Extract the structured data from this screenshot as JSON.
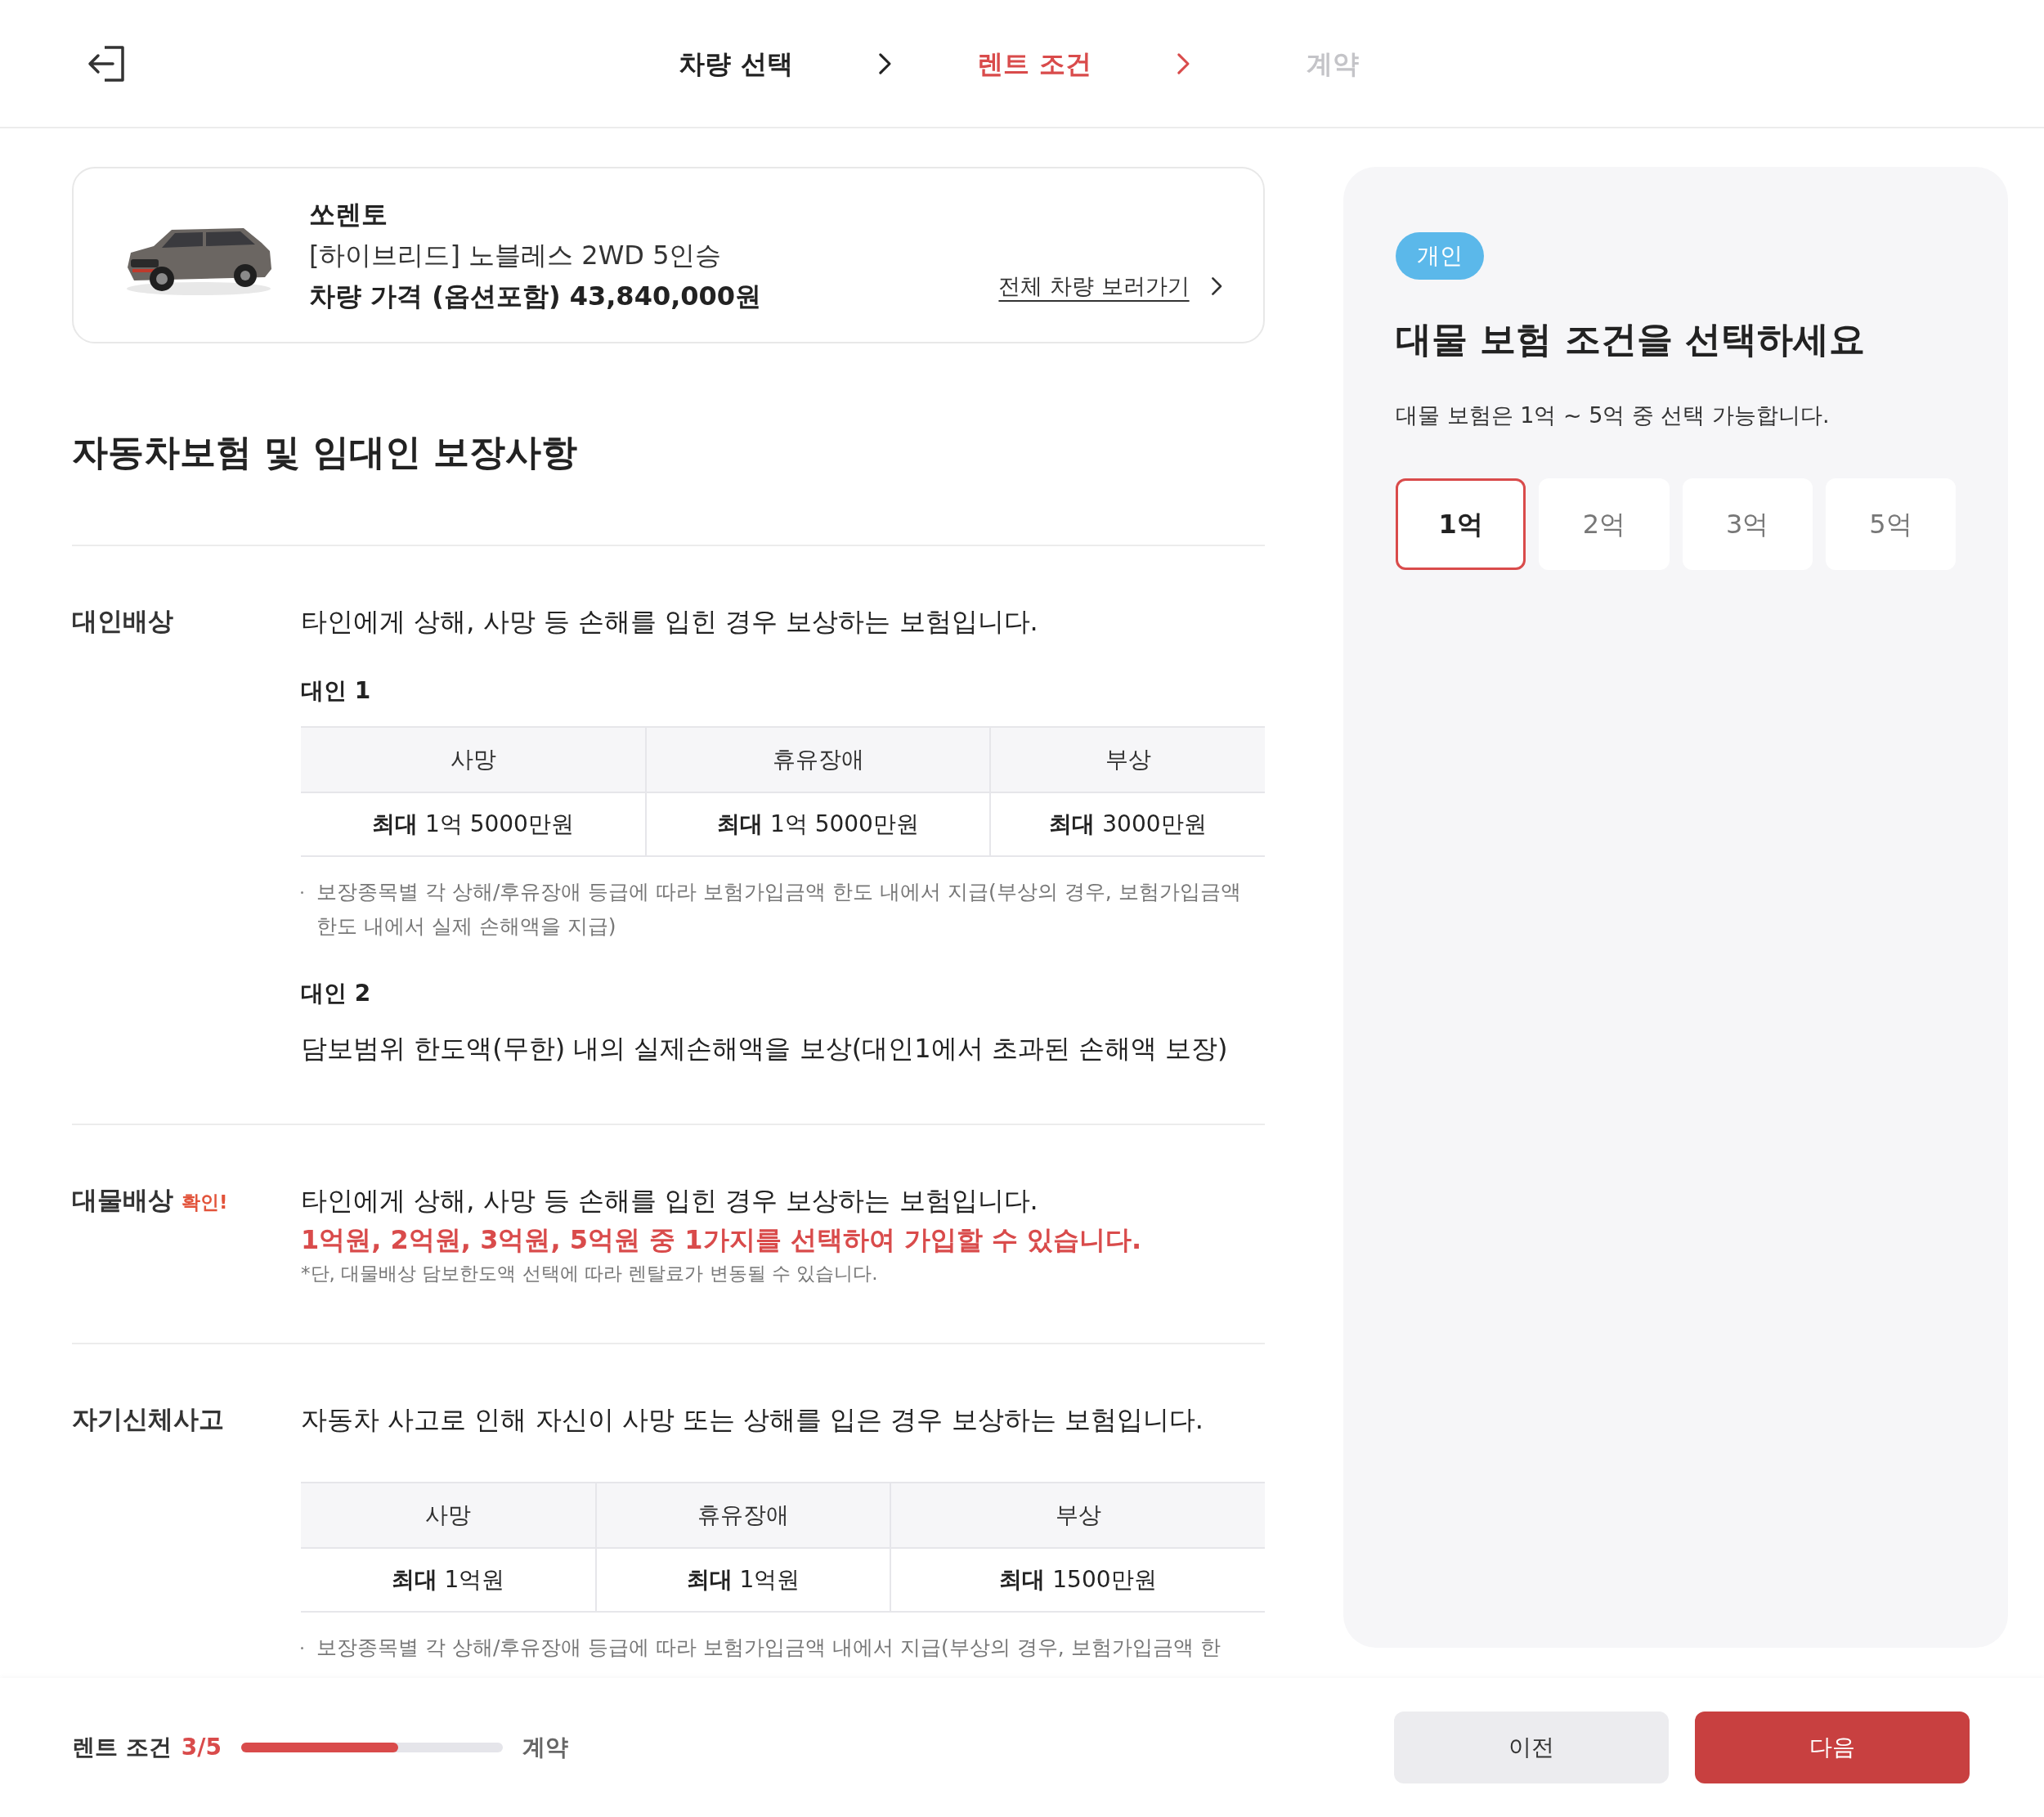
{
  "header": {
    "steps": [
      {
        "label": "차량 선택",
        "done": true,
        "selected": false
      },
      {
        "label": "렌트 조건",
        "done": false,
        "selected": true
      },
      {
        "label": "계약",
        "done": false,
        "selected": false
      }
    ]
  },
  "car": {
    "name": "쏘렌토",
    "trim": "[하이브리드] 노블레스 2WD 5인승",
    "price": "차량 가격 (옵션포함) 43,840,000원",
    "link": "전체 차량 보러가기"
  },
  "title": "자동차보험 및 임대인 보장사항",
  "sections": [
    {
      "label": "대인배상",
      "blocks": [
        {
          "kind": "text",
          "text": "타인에게 상해, 사망 등 손해를 입힌 경우 보상하는 보험입니다."
        },
        {
          "kind": "subheading",
          "text": "대인 1"
        },
        {
          "kind": "table",
          "columns": [
            "사망",
            "휴유장애",
            "부상"
          ],
          "rows": [
            [
              "**최대** 1억 5000만원",
              "**최대** 1억 5000만원",
              "**최대** 3000만원"
            ]
          ]
        },
        {
          "kind": "note",
          "text": "보장종목별 각 상해/후유장애 등급에 따라 보험가입금액 한도 내에서 지급(부상의 경우, 보험가입금액 한도 내에서 실제 손해액을 지급)"
        },
        {
          "kind": "subheading",
          "text": "대인 2"
        },
        {
          "kind": "text",
          "text": "담보범위 한도액(무한) 내의 실제손해액을 보상(대인1에서 초과된 손해액 보장)"
        }
      ]
    },
    {
      "label": "대물배상",
      "badge": "확인!",
      "blocks": [
        {
          "kind": "text",
          "text": "타인에게 상해, 사망 등 손해를 입힌 경우 보상하는 보험입니다."
        },
        {
          "kind": "highlight",
          "text": "1억원, 2억원, 3억원, 5억원 중 1가지를 선택하여 가입할 수 있습니다."
        },
        {
          "kind": "footnote",
          "text": "*단, 대물배상 담보한도액 선택에 따라 렌탈료가 변동될 수 있습니다."
        }
      ]
    },
    {
      "label": "자기신체사고",
      "blocks": [
        {
          "kind": "text",
          "text": "자동차 사고로 인해 자신이 사망 또는 상해를 입은 경우 보상하는 보험입니다."
        },
        {
          "kind": "table",
          "columns": [
            "사망",
            "휴유장애",
            "부상"
          ],
          "rows": [
            [
              "**최대** 1억원",
              "**최대** 1억원",
              "**최대** 1500만원"
            ]
          ]
        },
        {
          "kind": "note",
          "text": "보장종목별 각 상해/후유장애 등급에 따라 보험가입금액 내에서 지급(부상의 경우, 보험가입금액 한"
        }
      ]
    }
  ],
  "panel": {
    "badge": "개인",
    "title": "대물 보험 조건을 선택하세요",
    "subtitle": "대물 보험은 1억 ~ 5억 중 선택 가능합니다.",
    "options": [
      {
        "label": "1억",
        "selected": true
      },
      {
        "label": "2억",
        "selected": false
      },
      {
        "label": "3억",
        "selected": false
      },
      {
        "label": "5억",
        "selected": false
      }
    ]
  },
  "footer": {
    "step": "렌트 조건",
    "count": "3/5",
    "level": 0.6,
    "next_step": "계약",
    "buttons": [
      {
        "label": "이전",
        "kind": "secondary"
      },
      {
        "label": "다음",
        "kind": "primary"
      }
    ]
  }
}
